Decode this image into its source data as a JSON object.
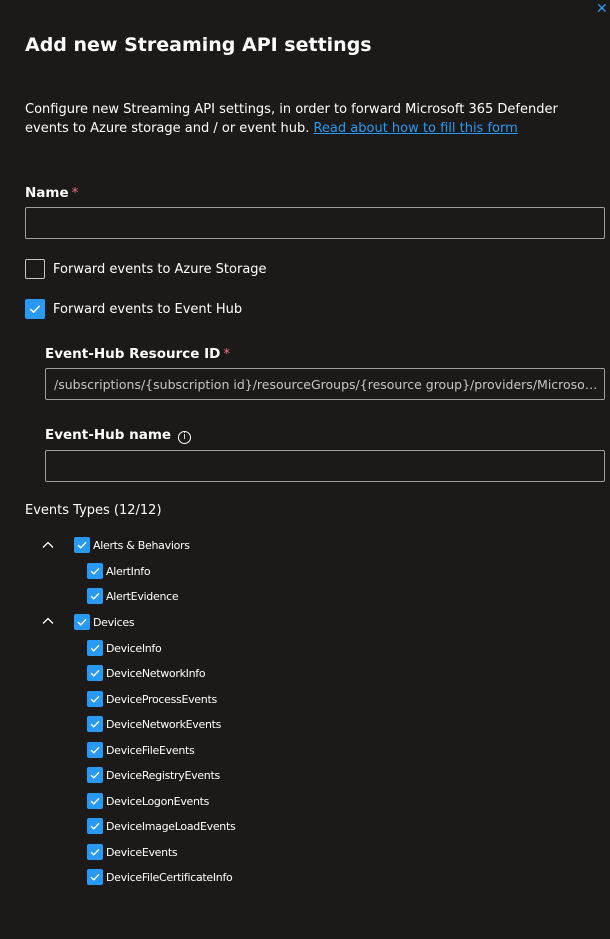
{
  "panel": {
    "title": "Add new Streaming API settings",
    "close_glyph": "✕",
    "description": "Configure new Streaming API settings, in order to forward Microsoft 365 Defender events to Azure storage and / or event hub.",
    "help_link": "Read about how to fill this form"
  },
  "form": {
    "name_label": "Name",
    "required_marker": "*",
    "name_value": "",
    "forward_storage": {
      "label": "Forward events to Azure Storage",
      "checked": false
    },
    "forward_eventhub": {
      "label": "Forward events to Event Hub",
      "checked": true
    },
    "eventhub_resource_id_label": "Event-Hub Resource ID",
    "eventhub_resource_id_placeholder": "/subscriptions/{subscription id}/resourceGroups/{resource group}/providers/Microsoft.EventHub/namespaces/{namespace}",
    "eventhub_name_label": "Event-Hub name",
    "info_glyph": "i",
    "eventhub_name_value": ""
  },
  "events": {
    "header": "Events Types (12/12)",
    "groups": [
      {
        "label": "Alerts & Behaviors",
        "expanded": true,
        "checked": true,
        "items": [
          {
            "label": "AlertInfo",
            "checked": true
          },
          {
            "label": "AlertEvidence",
            "checked": true
          }
        ]
      },
      {
        "label": "Devices",
        "expanded": true,
        "checked": true,
        "items": [
          {
            "label": "DeviceInfo",
            "checked": true
          },
          {
            "label": "DeviceNetworkInfo",
            "checked": true
          },
          {
            "label": "DeviceProcessEvents",
            "checked": true
          },
          {
            "label": "DeviceNetworkEvents",
            "checked": true
          },
          {
            "label": "DeviceFileEvents",
            "checked": true
          },
          {
            "label": "DeviceRegistryEvents",
            "checked": true
          },
          {
            "label": "DeviceLogonEvents",
            "checked": true
          },
          {
            "label": "DeviceImageLoadEvents",
            "checked": true
          },
          {
            "label": "DeviceEvents",
            "checked": true
          },
          {
            "label": "DeviceFileCertificateInfo",
            "checked": true
          }
        ]
      }
    ]
  },
  "colors": {
    "background": "#1b1a19",
    "accent": "#2899f5",
    "required": "#f1707b",
    "border": "#a19f9d"
  }
}
